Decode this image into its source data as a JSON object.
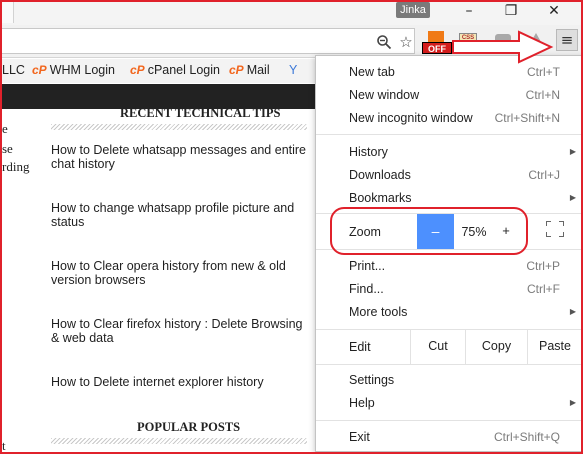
{
  "titlebar": {
    "user_name": "Jinka",
    "minimize_glyph": "–",
    "restore_glyph": "❐",
    "close_glyph": "✕"
  },
  "toolbar": {
    "zoom_glyph": "⚲",
    "star_glyph": "☆",
    "off_badge": "OFF",
    "css_badge": "CSS",
    "menu_glyph": "≡"
  },
  "bookmarks": [
    {
      "label": "LLC"
    },
    {
      "label": "WHM Login",
      "icon": "cp"
    },
    {
      "label": "cPanel Login",
      "icon": "cp"
    },
    {
      "label": "Mail",
      "icon": "cp"
    },
    {
      "label": "Y",
      "icon": "y"
    }
  ],
  "page": {
    "recent_title": "RECENT TECHNICAL TIPS",
    "popular_title": "POPULAR POSTS",
    "left_fragments": [
      "e",
      "se",
      "rding",
      "t"
    ],
    "posts": [
      "How to Delete whatsapp messages and entire chat history",
      "How to change whatsapp profile picture and status",
      "How to Clear opera history from new & old version browsers",
      "How to Clear firefox history : Delete Browsing & web data",
      "How to Delete internet explorer history"
    ]
  },
  "menu": {
    "new_tab": {
      "label": "New tab",
      "shortcut": "Ctrl+T"
    },
    "new_window": {
      "label": "New window",
      "shortcut": "Ctrl+N"
    },
    "new_incognito": {
      "label": "New incognito window",
      "shortcut": "Ctrl+Shift+N"
    },
    "history": {
      "label": "History"
    },
    "downloads": {
      "label": "Downloads",
      "shortcut": "Ctrl+J"
    },
    "bookmarks": {
      "label": "Bookmarks"
    },
    "zoom": {
      "label": "Zoom",
      "minus": "–",
      "value": "75%",
      "plus": "+"
    },
    "print": {
      "label": "Print...",
      "shortcut": "Ctrl+P"
    },
    "find": {
      "label": "Find...",
      "shortcut": "Ctrl+F"
    },
    "more_tools": {
      "label": "More tools"
    },
    "edit": {
      "label": "Edit",
      "cut": "Cut",
      "copy": "Copy",
      "paste": "Paste"
    },
    "settings": {
      "label": "Settings"
    },
    "help": {
      "label": "Help"
    },
    "exit": {
      "label": "Exit",
      "shortcut": "Ctrl+Shift+Q"
    },
    "submenu_arrow": "▶"
  },
  "colors": {
    "annotation_red": "#e0212b",
    "zoom_button_blue": "#4d90fe",
    "cpanel_orange": "#f2661d",
    "page_band": "#222222"
  }
}
